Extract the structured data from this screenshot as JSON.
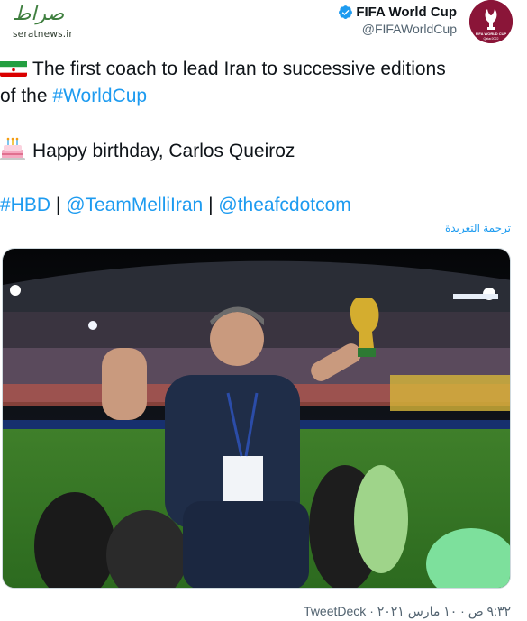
{
  "watermark": {
    "script_logo": "صراط",
    "site": "seratnews.ir"
  },
  "author": {
    "name": "FIFA World Cup",
    "handle": "@FIFAWorldCup",
    "avatar_label": "FIFA WORLD CUP Qatar2022"
  },
  "tweet": {
    "line1_text": "The first coach to lead Iran to successive editions",
    "line2_prefix": "of the ",
    "line2_hashtag": "#WorldCup",
    "birthday_text": "Happy birthday, Carlos Queiroz",
    "tags": [
      {
        "text": "#HBD"
      },
      {
        "text": "@TeamMelliIran"
      },
      {
        "text": "@theafcdotcom"
      }
    ],
    "separator": "|"
  },
  "translate_label": "ترجمة التغريدة",
  "photo": {
    "description_icon": "stadium-celebration-photo"
  },
  "footer": {
    "time_date": "٩:٣٢ ص · ١٠ مارس ٢٠٢١",
    "source": "TweetDeck"
  },
  "colors": {
    "link": "#1d9bf0",
    "text": "#0f1419",
    "muted": "#536471",
    "avatar_bg": "#8a1538"
  }
}
